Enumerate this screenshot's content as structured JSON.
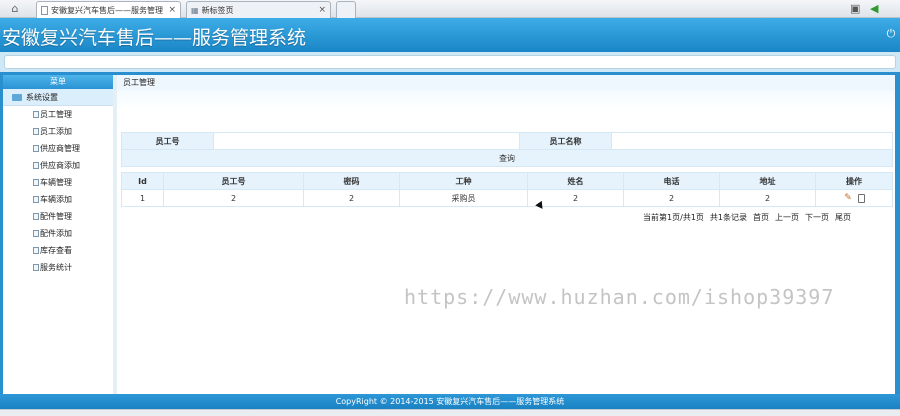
{
  "browser": {
    "tabs": [
      {
        "label": "安徽复兴汽车售后——服务管理",
        "icon": "page-icon"
      },
      {
        "label": "新标签页",
        "icon": "grid-icon"
      }
    ],
    "close_symbol": "×"
  },
  "app": {
    "title": "安徽复兴汽车售后——服务管理系统"
  },
  "sidebar": {
    "menu_title": "菜单",
    "group": "系统设置",
    "items": [
      {
        "label": "员工管理"
      },
      {
        "label": "员工添加"
      },
      {
        "label": "供应商管理"
      },
      {
        "label": "供应商添加"
      },
      {
        "label": "车辆管理"
      },
      {
        "label": "车辆添加"
      },
      {
        "label": "配件管理"
      },
      {
        "label": "配件添加"
      },
      {
        "label": "库存查看"
      },
      {
        "label": "服务统计"
      }
    ]
  },
  "main": {
    "breadcrumb": "员工管理",
    "search": {
      "field1_label": "员工号",
      "field1_value": "",
      "field2_label": "员工名称",
      "field2_value": "",
      "query_button": "查询"
    },
    "table": {
      "headers": [
        "Id",
        "员工号",
        "密码",
        "工种",
        "姓名",
        "电话",
        "地址",
        "操作"
      ],
      "rows": [
        {
          "id": "1",
          "emp_no": "2",
          "password": "2",
          "job": "采购员",
          "name": "2",
          "phone": "2",
          "address": "2"
        }
      ]
    },
    "pager": {
      "info": "当前第1页/共1页",
      "count": "共1条记录",
      "first": "首页",
      "prev": "上一页",
      "next": "下一页",
      "last": "尾页"
    }
  },
  "watermark": "https://www.huzhan.com/ishop39397",
  "footer": "CopyRight © 2014-2015 安徽复兴汽车售后——服务管理系统",
  "colors": {
    "accent": "#1a86c7",
    "header_light": "#3dace6",
    "row_bg": "#e6f3fc"
  }
}
